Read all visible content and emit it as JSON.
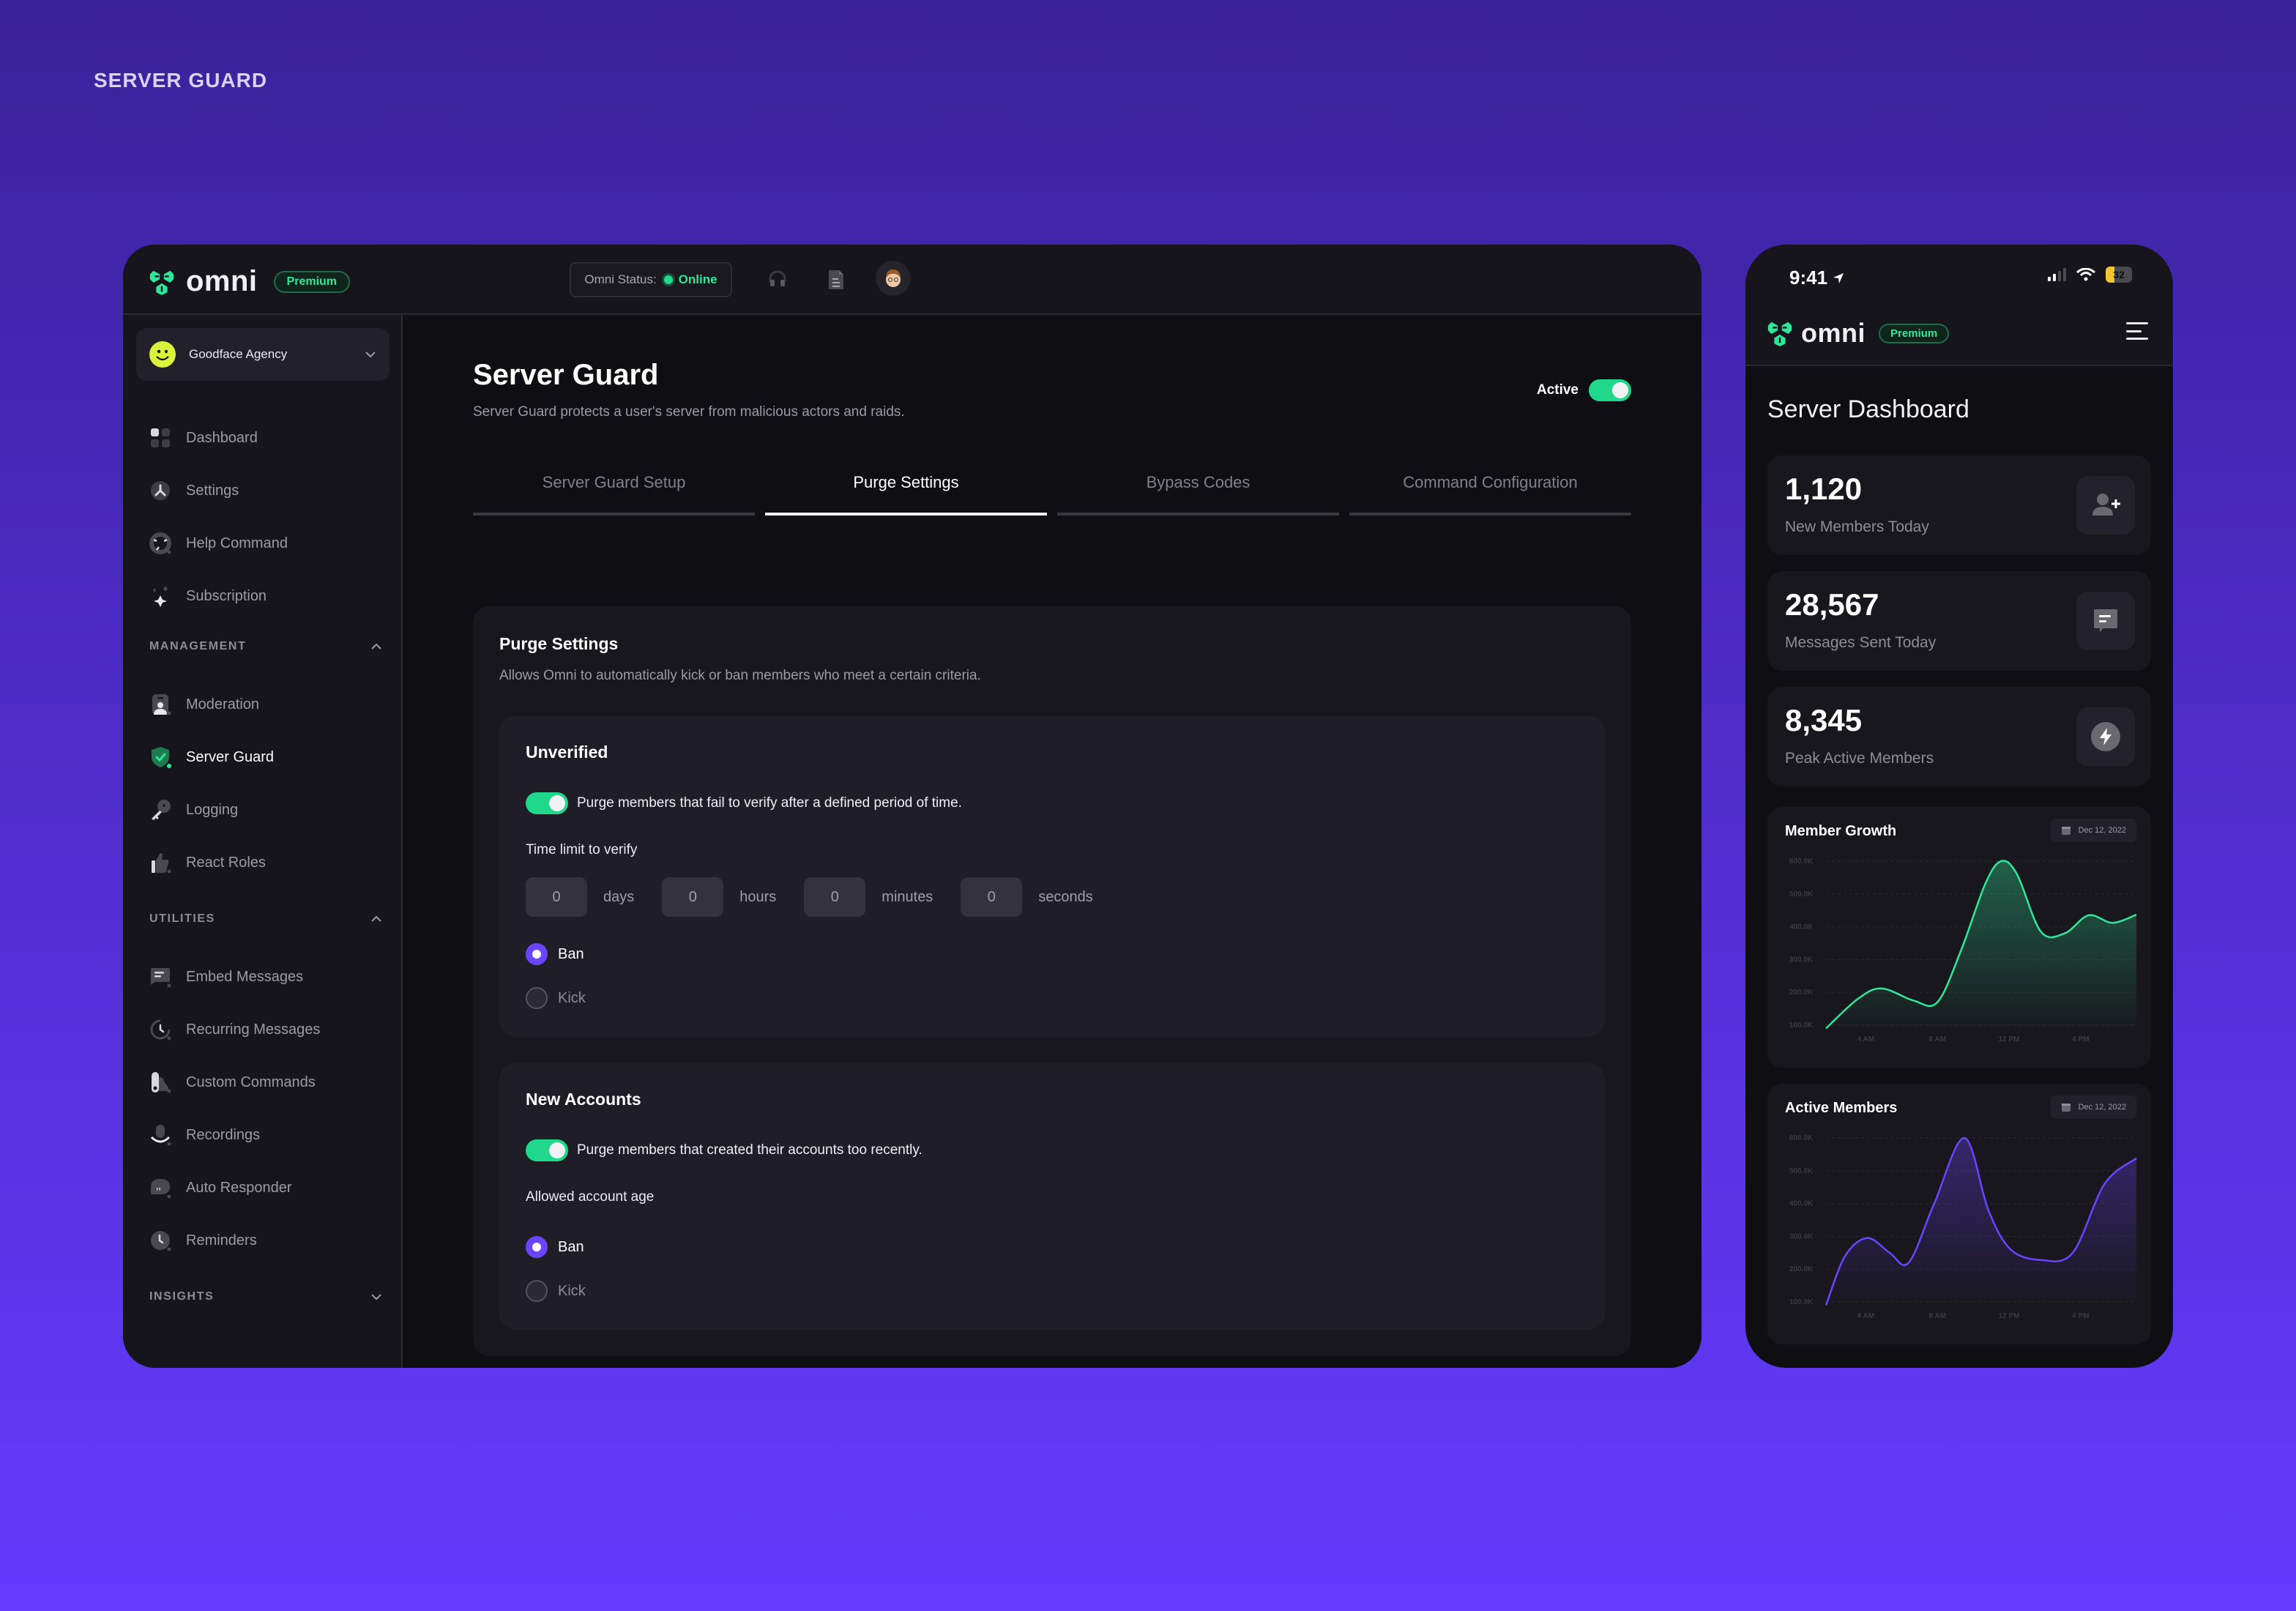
{
  "page_label": "SERVER GUARD",
  "colors": {
    "accent_green": "#1fd88b",
    "accent_purple": "#6a45ff",
    "background_purple": "#643bff"
  },
  "desktop": {
    "brand": {
      "name": "omni",
      "badge": "Premium",
      "logo_icon": "omni-logo-icon"
    },
    "topbar": {
      "status_label": "Omni Status:",
      "status_value": "Online",
      "icons": [
        "headset-icon",
        "document-icon",
        "user-avatar"
      ]
    },
    "sidebar": {
      "server": {
        "name": "Goodface Agency",
        "icon": "smiley-icon"
      },
      "items": [
        {
          "label": "Dashboard",
          "icon": "dashboard-icon"
        },
        {
          "label": "Settings",
          "icon": "settings-icon"
        },
        {
          "label": "Help Command",
          "icon": "help-icon"
        },
        {
          "label": "Subscription",
          "icon": "sparkle-icon"
        }
      ],
      "sections": [
        {
          "title": "MANAGEMENT",
          "expanded": true,
          "items": [
            {
              "label": "Moderation",
              "icon": "moderation-icon"
            },
            {
              "label": "Server Guard",
              "icon": "shield-check-icon",
              "active": true
            },
            {
              "label": "Logging",
              "icon": "key-icon"
            },
            {
              "label": "React Roles",
              "icon": "thumbs-up-icon"
            }
          ]
        },
        {
          "title": "UTILITIES",
          "expanded": true,
          "items": [
            {
              "label": "Embed Messages",
              "icon": "message-icon"
            },
            {
              "label": "Recurring Messages",
              "icon": "recurring-clock-icon"
            },
            {
              "label": "Custom Commands",
              "icon": "custom-commands-icon"
            },
            {
              "label": "Recordings",
              "icon": "microphone-icon"
            },
            {
              "label": "Auto Responder",
              "icon": "quote-bubble-icon"
            },
            {
              "label": "Reminders",
              "icon": "clock-icon"
            }
          ]
        },
        {
          "title": "INSIGHTS",
          "expanded": false,
          "items": []
        }
      ]
    },
    "main": {
      "title": "Server Guard",
      "description": "Server Guard protects a user's server from malicious actors and raids.",
      "active_label": "Active",
      "active": true,
      "tabs": [
        {
          "label": "Server Guard Setup",
          "active": false
        },
        {
          "label": "Purge Settings",
          "active": true
        },
        {
          "label": "Bypass Codes",
          "active": false
        },
        {
          "label": "Command Configuration",
          "active": false
        }
      ],
      "purge": {
        "title": "Purge Settings",
        "description": "Allows Omni to automatically kick or ban members who meet a certain criteria.",
        "unverified": {
          "title": "Unverified",
          "toggle_label": "Purge members that fail to verify after a defined period of time.",
          "toggle_on": true,
          "time_label": "Time limit to verify",
          "time": [
            {
              "value": "0",
              "unit": "days"
            },
            {
              "value": "0",
              "unit": "hours"
            },
            {
              "value": "0",
              "unit": "minutes"
            },
            {
              "value": "0",
              "unit": "seconds"
            }
          ],
          "options": [
            {
              "label": "Ban",
              "checked": true
            },
            {
              "label": "Kick",
              "checked": false
            }
          ]
        },
        "new_accounts": {
          "title": "New Accounts",
          "toggle_label": "Purge members that created their accounts too recently.",
          "toggle_on": true,
          "age_label": "Allowed account age",
          "options": [
            {
              "label": "Ban",
              "checked": true
            },
            {
              "label": "Kick",
              "checked": false
            }
          ]
        }
      }
    }
  },
  "phone": {
    "status_bar": {
      "time": "9:41",
      "battery": "32",
      "battery_level": 0.32
    },
    "brand": {
      "name": "omni",
      "badge": "Premium"
    },
    "title": "Server Dashboard",
    "stats": [
      {
        "value": "1,120",
        "label": "New Members Today",
        "icon": "user-plus-icon"
      },
      {
        "value": "28,567",
        "label": "Messages Sent Today",
        "icon": "chat-icon"
      },
      {
        "value": "8,345",
        "label": "Peak Active Members",
        "icon": "lightning-icon"
      }
    ]
  },
  "chart_data": [
    {
      "type": "area",
      "title": "Member Growth",
      "date": "Dec 12, 2022",
      "x_ticks": [
        "4 AM",
        "8 AM",
        "12 PM",
        "4 PM"
      ],
      "y_ticks": [
        "600.0K",
        "500.0K",
        "400.0K",
        "300.0K",
        "200.0K",
        "100.0K"
      ],
      "ylim": [
        100000,
        600000
      ],
      "xlim": [
        1,
        20.5
      ],
      "grid": true,
      "color": "#2ee89a",
      "series": [
        {
          "name": "Member Growth",
          "x": [
            1,
            3,
            4.5,
            6.5,
            8,
            9.5,
            11,
            12,
            13,
            14.5,
            16,
            17.5,
            19,
            20.5
          ],
          "y": [
            90000,
            180000,
            212000,
            175000,
            170000,
            330000,
            530000,
            600000,
            560000,
            385000,
            380000,
            435000,
            412000,
            437000
          ]
        }
      ]
    },
    {
      "type": "area",
      "title": "Active Members",
      "date": "Dec 12, 2022",
      "x_ticks": [
        "4 AM",
        "8 AM",
        "12 PM",
        "4 PM"
      ],
      "y_ticks": [
        "600.0K",
        "500.0K",
        "400.0K",
        "300.0K",
        "200.0K",
        "100.0K"
      ],
      "ylim": [
        100000,
        600000
      ],
      "xlim": [
        1,
        20.5
      ],
      "grid": true,
      "color": "#6a45ff",
      "series": [
        {
          "name": "Active Members",
          "x": [
            1,
            2.2,
            3.6,
            5,
            6.2,
            7.8,
            9.7,
            11.2,
            12.6,
            14.5,
            16.5,
            18.5,
            20.5
          ],
          "y": [
            90000,
            240000,
            295000,
            250000,
            220000,
            400000,
            600000,
            380000,
            260000,
            228000,
            250000,
            460000,
            538000
          ]
        }
      ]
    }
  ]
}
